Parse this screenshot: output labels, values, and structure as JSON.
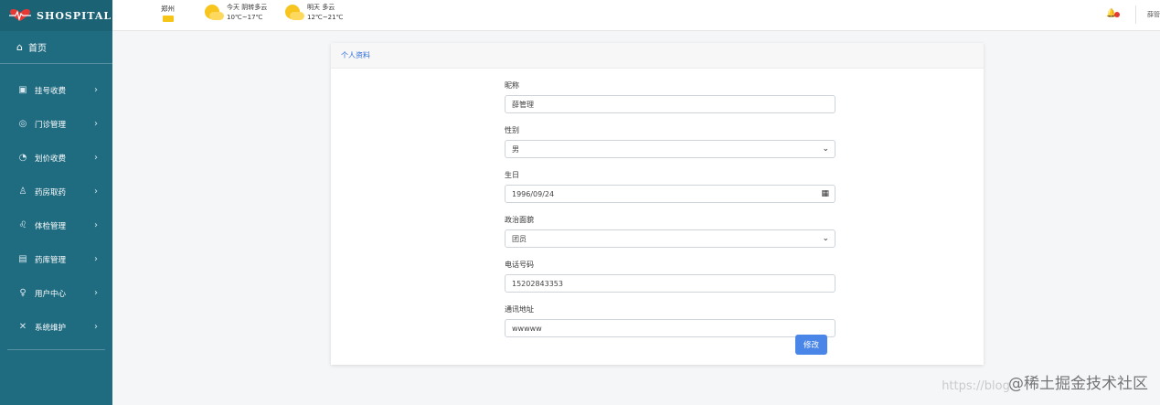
{
  "brand": {
    "name": "SHOSPITAL"
  },
  "sidebar": {
    "home_label": "首页",
    "items": [
      {
        "label": "挂号收费",
        "icon": "id-card-icon"
      },
      {
        "label": "门诊管理",
        "icon": "target-icon"
      },
      {
        "label": "划价收费",
        "icon": "money-icon"
      },
      {
        "label": "药房取药",
        "icon": "user-medicine-icon"
      },
      {
        "label": "体检管理",
        "icon": "stethoscope-icon"
      },
      {
        "label": "药库管理",
        "icon": "warehouse-icon"
      },
      {
        "label": "用户中心",
        "icon": "user-icon"
      },
      {
        "label": "系统维护",
        "icon": "tools-icon"
      }
    ]
  },
  "topbar": {
    "city": "郑州",
    "today": {
      "label": "今天 阴转多云",
      "temp": "10℃~17℃"
    },
    "tomorrow": {
      "label": "明天 多云",
      "temp": "12℃~21℃"
    },
    "user_text": "薛管"
  },
  "card": {
    "title": "个人资料",
    "fields": {
      "nickname_label": "昵称",
      "nickname_value": "薛管理",
      "gender_label": "性别",
      "gender_value": "男",
      "birthday_label": "生日",
      "birthday_value": "1996/09/24",
      "politics_label": "政治面貌",
      "politics_value": "团员",
      "phone_label": "电话号码",
      "phone_value": "15202843353",
      "address_label": "通讯地址",
      "address_value": "wwwww"
    },
    "submit_label": "修改"
  },
  "watermark": {
    "text": "@稀土掘金技术社区",
    "url": "https://blog."
  }
}
